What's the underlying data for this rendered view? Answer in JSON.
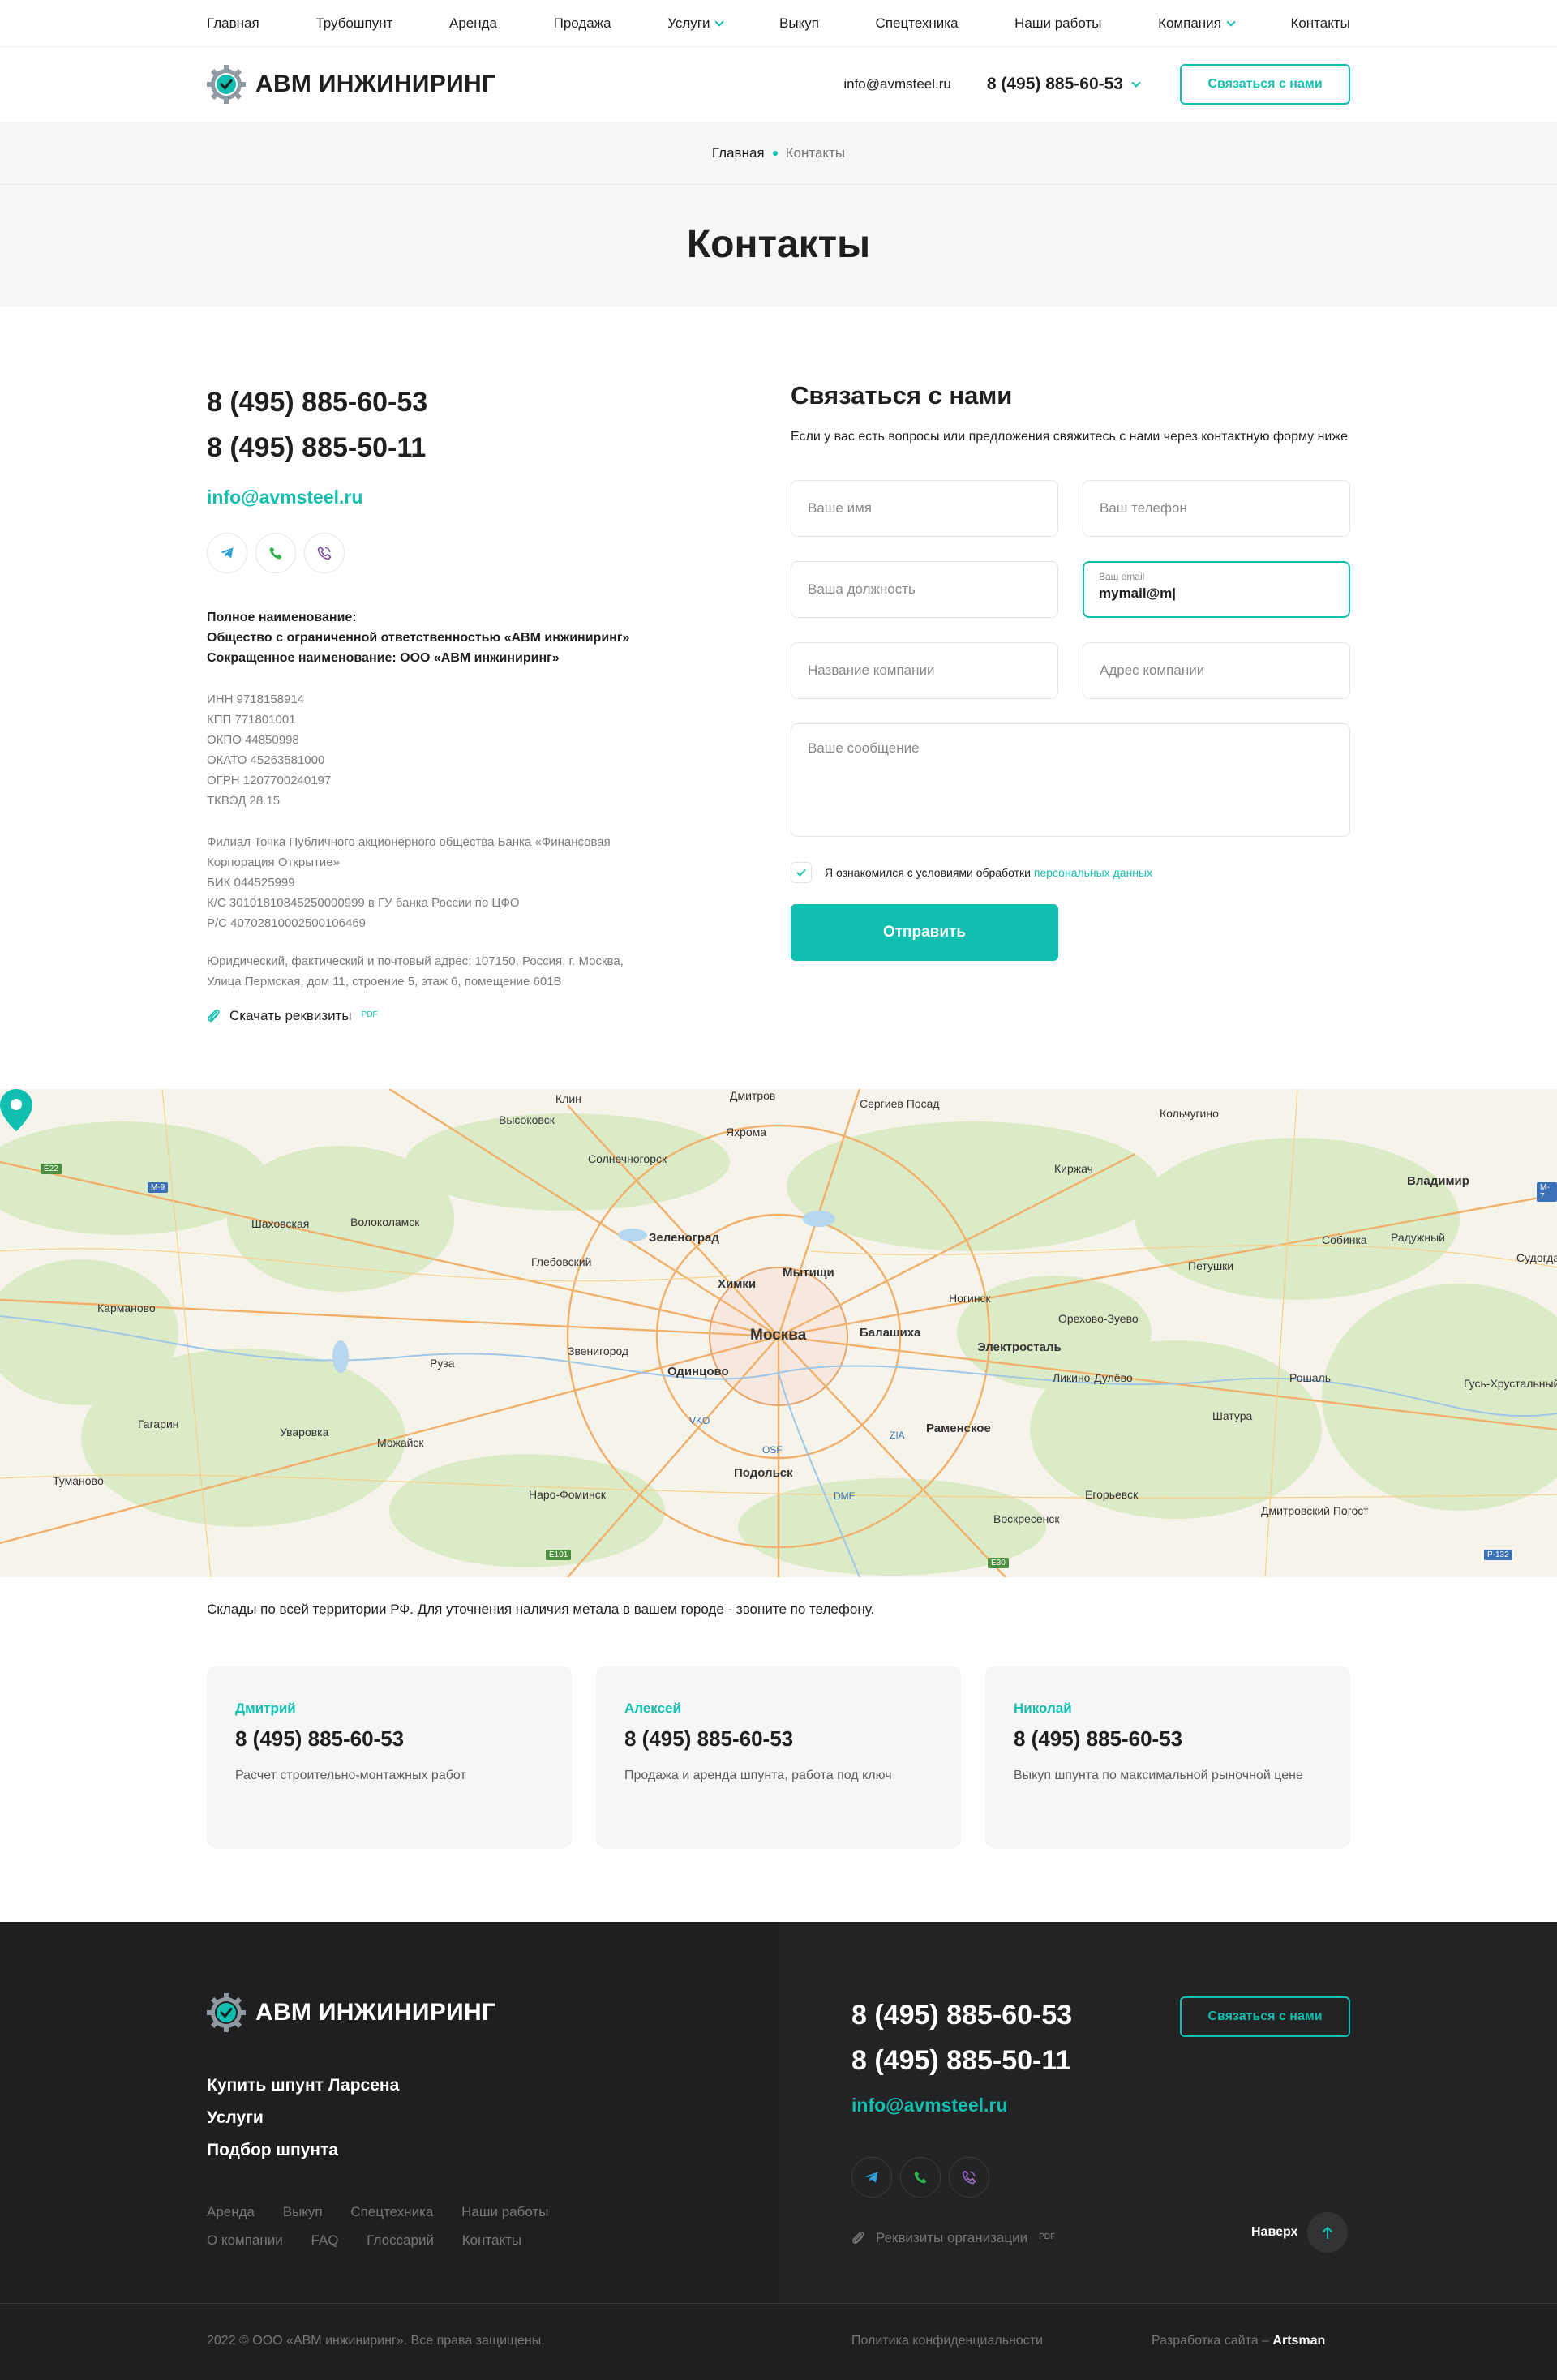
{
  "topnav": {
    "items": [
      {
        "label": "Главная"
      },
      {
        "label": "Трубошпунт"
      },
      {
        "label": "Аренда"
      },
      {
        "label": "Продажа"
      },
      {
        "label": "Услуги"
      },
      {
        "label": "Выкуп"
      },
      {
        "label": "Спецтехника"
      },
      {
        "label": "Наши работы"
      },
      {
        "label": "Компания"
      },
      {
        "label": "Контакты"
      }
    ]
  },
  "header": {
    "brand": "АВМ ИНЖИНИРИНГ",
    "email": "info@avmsteel.ru",
    "phone": "8 (495) 885-60-53",
    "cta": "Связаться с нами"
  },
  "breadcrumb": {
    "home": "Главная",
    "current": "Контакты"
  },
  "page_title": "Контакты",
  "contacts": {
    "phone1": "8 (495) 885-60-53",
    "phone2": "8 (495) 885-50-11",
    "email": "info@avmsteel.ru",
    "full_name_label": "Полное наименование:",
    "full_name": "Общество с ограниченной ответственностью «АВМ инжиниринг»",
    "short_name": "Сокращенное наименование: ООО «АВМ инжиниринг»",
    "codes": [
      "ИНН 9718158914",
      "КПП 771801001",
      "ОКПО 44850998",
      "ОКАТО 45263581000",
      "ОГРН 1207700240197",
      "ТКВЭД 28.15"
    ],
    "bank": [
      "Филиал Точка Публичного акционерного общества Банка «Финансовая",
      "Корпорация Открытие»",
      "БИК 044525999",
      "К/С 30101810845250000999 в ГУ банка России по ЦФО",
      "Р/С 40702810002500106469"
    ],
    "address": [
      "Юридический, фактический и почтовый адрес: 107150, Россия, г. Москва,",
      "Улица Пермская, дом 11, строение 5, этаж 6, помещение 601В"
    ],
    "download": "Скачать реквизиты",
    "pdf": "PDF"
  },
  "form": {
    "title": "Связаться с нами",
    "desc": "Если у вас есть вопросы или предложения свяжитесь с нами через контактную форму ниже",
    "name_ph": "Ваше имя",
    "phone_ph": "Ваш телефон",
    "position_ph": "Ваша должность",
    "email_label": "Ваш email",
    "email_value": "mymail@m|",
    "company_ph": "Название компании",
    "address_ph": "Адрес компании",
    "message_ph": "Ваше сообщение",
    "agree_text": "Я ознакомился с условиями обработки",
    "agree_link": "персональных данных",
    "submit": "Отправить"
  },
  "map": {
    "labels": [
      "Клин",
      "Высоковск",
      "Дмитров",
      "Яхрома",
      "Сергиев Посад",
      "Кольчугино",
      "Солнечногорск",
      "Киржач",
      "Владимир",
      "Шаховская",
      "Волоколамск",
      "Зеленоград",
      "Глебовский",
      "Мытищи",
      "Химки",
      "Петушки",
      "Собинка",
      "Радужный",
      "Судогда",
      "Карманово",
      "Ногинск",
      "Орехово-Зуево",
      "Балашиха",
      "Москва",
      "Электросталь",
      "Звенигород",
      "Руза",
      "Одинцово",
      "Ликино-Дулёво",
      "Рошаль",
      "Гусь-Хрустальный",
      "Гагарин",
      "Уваровка",
      "Можайск",
      "Шатура",
      "Раменское",
      "Подольск",
      "Тумановo",
      "Наро-Фоминск",
      "Егорьевск",
      "Воскресенск",
      "Дмитровский Погост",
      "VKO",
      "OSF",
      "ZIA",
      "DME",
      "M-9",
      "E22",
      "E101",
      "E30",
      "P-132",
      "M-7"
    ]
  },
  "warehouse_note": "Склады по всей территории РФ. Для уточнения наличия метала в вашем городе - звоните по телефону.",
  "managers": [
    {
      "name": "Дмитрий",
      "phone": "8 (495) 885-60-53",
      "desc": "Расчет строительно-монтажных работ"
    },
    {
      "name": "Алексей",
      "phone": "8 (495) 885-60-53",
      "desc": "Продажа и аренда шпунта, работа под ключ"
    },
    {
      "name": "Николай",
      "phone": "8 (495) 885-60-53",
      "desc": "Выкуп шпунта по максимальной рыночной цене"
    }
  ],
  "footer": {
    "brand": "АВМ ИНЖИНИРИНГ",
    "links": [
      "Купить шпунт Ларсена",
      "Услуги",
      "Подбор шпунта"
    ],
    "small_links": [
      "Аренда",
      "Выкуп",
      "Спецтехника",
      "Наши работы",
      "О компании",
      "FAQ",
      "Глоссарий",
      "Контакты"
    ],
    "phone1": "8 (495) 885-60-53",
    "phone2": "8 (495) 885-50-11",
    "email": "info@avmsteel.ru",
    "requisites": "Реквизиты организации",
    "pdf": "PDF",
    "cta": "Связаться с нами",
    "up": "Наверх",
    "copyright": "2022 © ООО «АВМ инжиниринг». Все права защищены.",
    "policy": "Политика конфиденциальности",
    "dev_label": "Разработка сайта –",
    "dev_name": "Artsman"
  },
  "colors": {
    "accent": "#10bfb0",
    "dark": "#1f1f21",
    "light_bg": "#f6f6f6"
  }
}
